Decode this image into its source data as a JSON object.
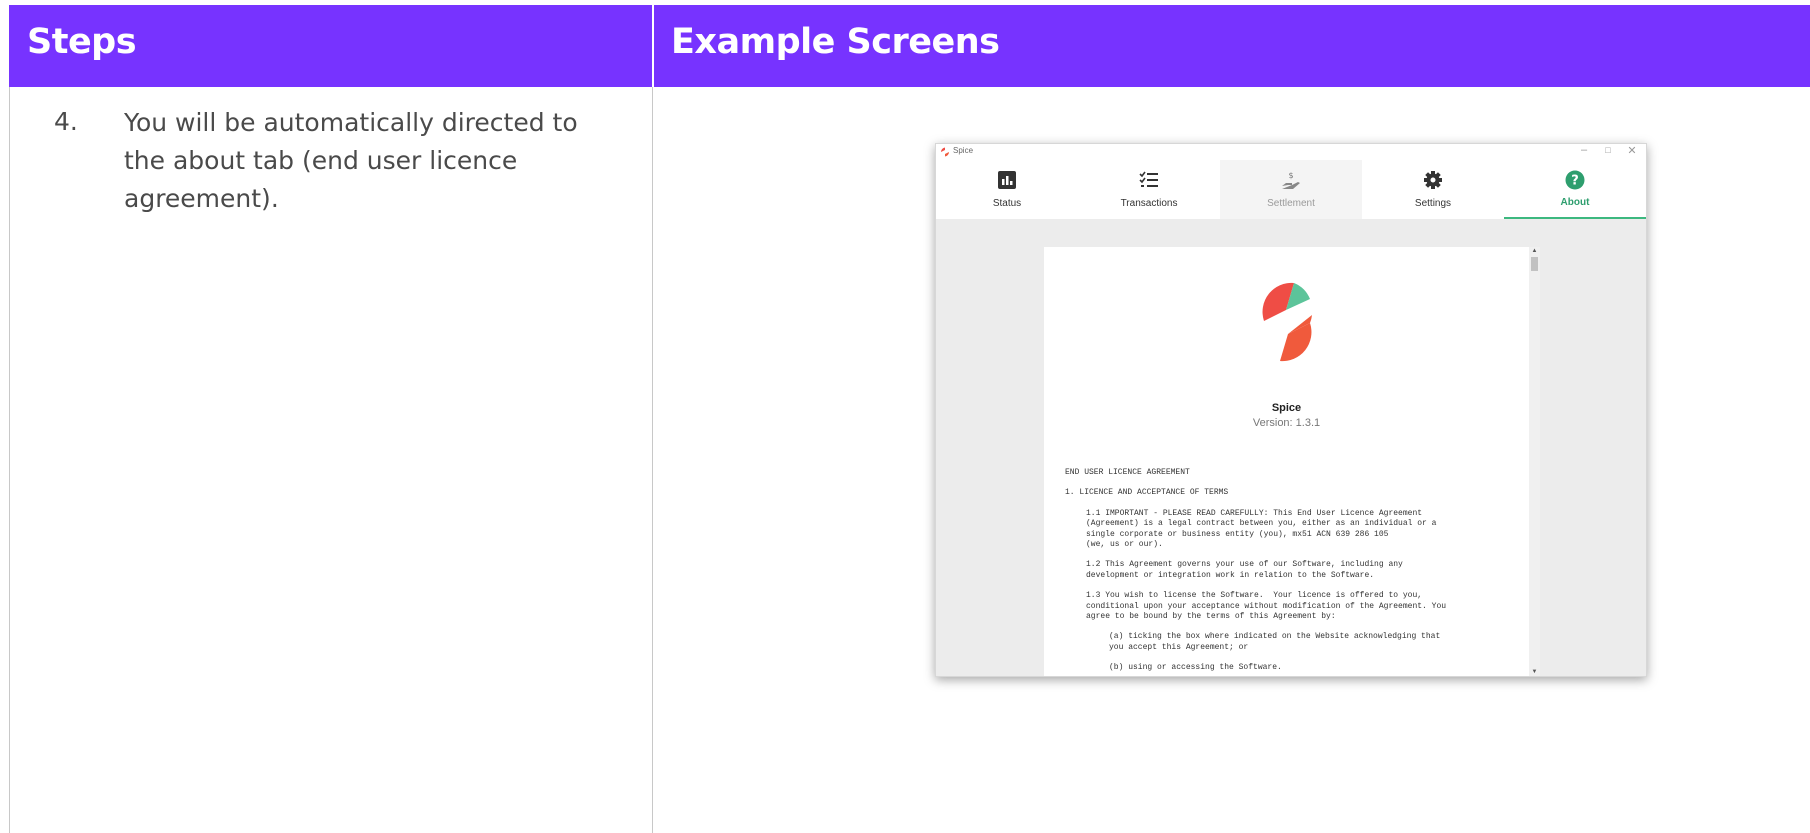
{
  "header": {
    "steps_title": "Steps",
    "examples_title": "Example Screens",
    "color": "#7733ff"
  },
  "step": {
    "number": "4.",
    "text": "You will be automatically directed to the about tab (end user licence agreement)."
  },
  "app": {
    "window_title": "Spice",
    "window_controls": {
      "minimize": "–",
      "maximize": "□",
      "close": "✕"
    },
    "tabs": [
      {
        "label": "Status",
        "icon": "bar-chart-icon",
        "state": "normal"
      },
      {
        "label": "Transactions",
        "icon": "checklist-icon",
        "state": "normal"
      },
      {
        "label": "Settlement",
        "icon": "hand-dollar-icon",
        "state": "disabled"
      },
      {
        "label": "Settings",
        "icon": "gear-icon",
        "state": "normal"
      },
      {
        "label": "About",
        "icon": "question-circle-icon",
        "state": "active"
      }
    ],
    "about": {
      "name": "Spice",
      "version": "Version: 1.3.1",
      "eula_title": "END USER LICENCE AGREEMENT",
      "section1": "1. LICENCE AND ACCEPTANCE OF TERMS",
      "p1_1": "1.1 IMPORTANT - PLEASE READ CAREFULLY: This End User Licence Agreement\n(Agreement) is a legal contract between you, either as an individual or a\nsingle corporate or business entity (you), mx51 ACN 639 286 105\n(we, us or our).",
      "p1_2": "1.2 This Agreement governs your use of our Software, including any\ndevelopment or integration work in relation to the Software.",
      "p1_3": "1.3 You wish to license the Software.  Your licence is offered to you,\nconditional upon your acceptance without modification of the Agreement. You\nagree to be bound by the terms of this Agreement by:",
      "p_a": "(a) ticking the box where indicated on the Website acknowledging that\nyou accept this Agreement; or",
      "p_b": "(b) using or accessing the Software."
    },
    "colors": {
      "accent": "#3cb87f",
      "logo_red": "#ef4d45",
      "logo_green": "#5cc49a",
      "logo_orange": "#f05a3c"
    }
  }
}
